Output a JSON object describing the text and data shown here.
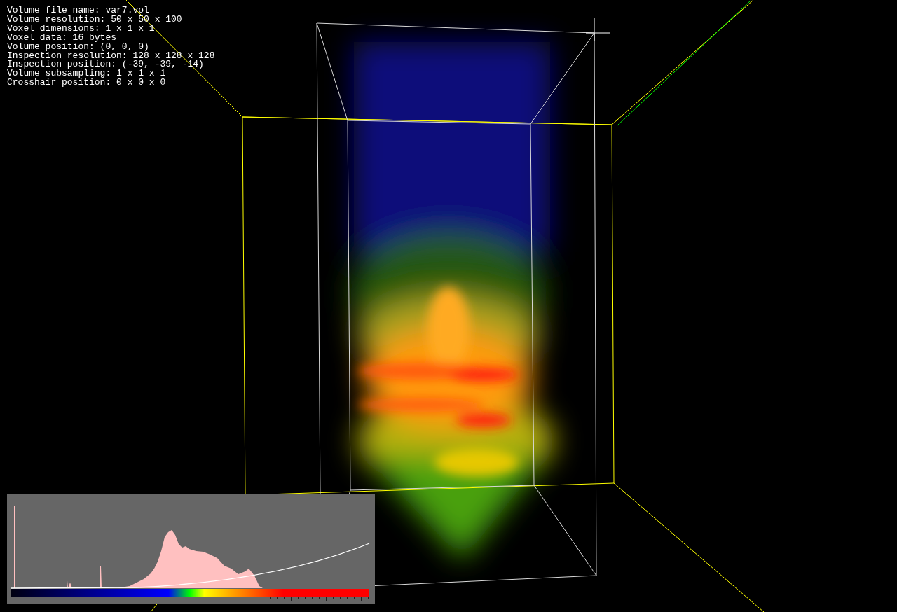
{
  "info_lines": [
    "Volume file name: var7.vol",
    "Volume resolution: 50 x 50 x 100",
    "Voxel dimensions: 1 x 1 x 1",
    "Voxel data: 16 bytes",
    "Volume position: (0, 0, 0)",
    "Inspection resolution: 128 x 128 x 128",
    "Inspection position: (-39, -39, -14)",
    "Volume subsampling: 1 x 1 x 1",
    "Crosshair position: 0 x 0 x 0"
  ]
}
